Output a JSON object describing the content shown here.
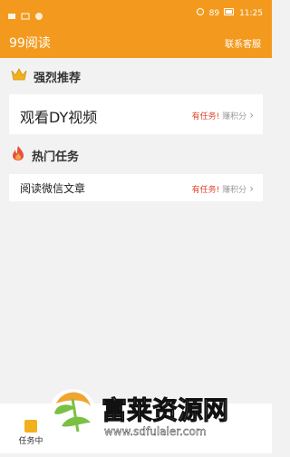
{
  "status_bar": {
    "time": "11:25",
    "signal_label": "89"
  },
  "app": {
    "title": "99阅读",
    "contact_label": "联系客服"
  },
  "sections": {
    "recommended": {
      "label": "强烈推荐"
    },
    "hot": {
      "label": "热门任务"
    }
  },
  "tasks": [
    {
      "title": "观看DY视频",
      "status": "有任务!",
      "points": "赚积分"
    },
    {
      "title": "阅读微信文章",
      "status": "有任务!",
      "points": "赚积分"
    }
  ],
  "bottom_nav": {
    "tab_label": "任务中"
  },
  "watermark": {
    "name": "富莱资源网",
    "url": "www.sdfulaier.com"
  },
  "colors": {
    "accent": "#f39a1e",
    "task_status": "#e0452c"
  }
}
